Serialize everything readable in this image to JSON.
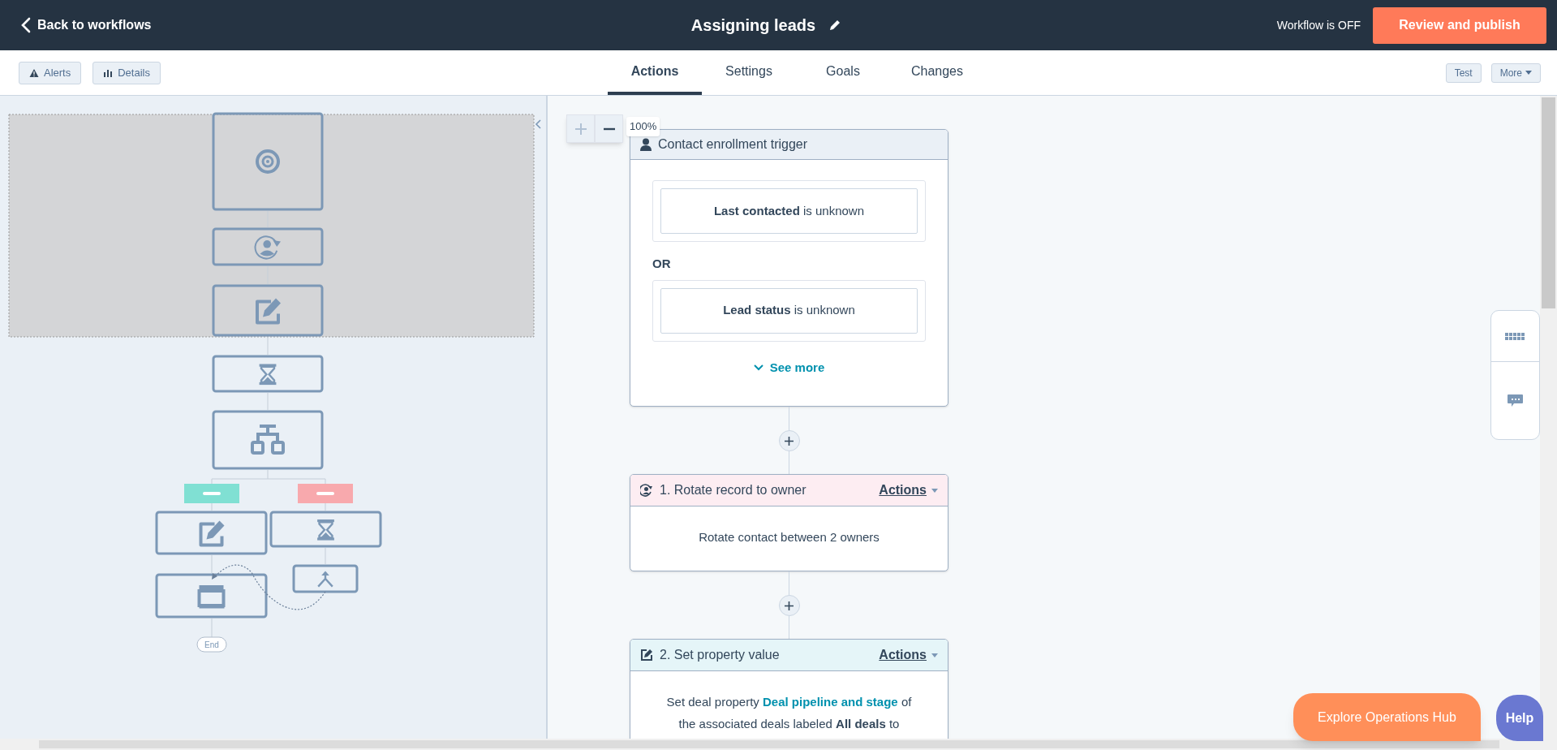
{
  "header": {
    "back_link": "Back to workflows",
    "title": "Assigning leads",
    "status": "Workflow is OFF",
    "publish_button": "Review and publish"
  },
  "toolbar": {
    "left_buttons": [
      {
        "kind": "alerts",
        "label": "Alerts"
      },
      {
        "kind": "details",
        "label": "Details"
      }
    ],
    "tabs": [
      {
        "label": "Actions",
        "selected": true
      },
      {
        "label": "Settings",
        "selected": false
      },
      {
        "label": "Goals",
        "selected": false
      },
      {
        "label": "Changes",
        "selected": false
      }
    ],
    "test_button": "Test",
    "more_button": "More"
  },
  "minimap": {
    "nodes": [
      {
        "kind": "trigger"
      },
      {
        "kind": "rotate"
      },
      {
        "kind": "set_property"
      },
      {
        "kind": "delay"
      },
      {
        "kind": "branch"
      }
    ],
    "branches": [
      {
        "color": "#80e0d3",
        "nodes": [
          {
            "kind": "set_property"
          },
          {
            "kind": "ticket"
          }
        ]
      },
      {
        "color": "#f8a9ad",
        "nodes": [
          {
            "kind": "delay"
          },
          {
            "kind": "go_to"
          }
        ]
      }
    ],
    "end_label": "End"
  },
  "canvas": {
    "zoom_level": "100%",
    "trigger": {
      "title": "Contact enrollment trigger",
      "filters": [
        "**Last contacted** is unknown",
        "**Lead status** is unknown"
      ],
      "separator": "OR",
      "see_more": "See more"
    },
    "actions": [
      {
        "kind": "rotate",
        "title": "1. Rotate record to owner",
        "menu": "Actions",
        "description": [
          {
            "kind": "plain",
            "text": "Rotate contact between 2 owners"
          }
        ]
      },
      {
        "kind": "set_property",
        "title": "2. Set property value",
        "menu": "Actions",
        "description": [
          {
            "kind": "plain",
            "text": "Set deal property "
          },
          {
            "kind": "link",
            "text": "Deal pipeline and stage"
          },
          {
            "kind": "plain",
            "text": " of the associated deals labeled "
          },
          {
            "kind": "bold",
            "text": "All deals"
          },
          {
            "kind": "plain",
            "text": " to"
          }
        ]
      }
    ]
  },
  "footer": {
    "explore_button": "Explore Operations Hub",
    "help_button": "Help"
  }
}
